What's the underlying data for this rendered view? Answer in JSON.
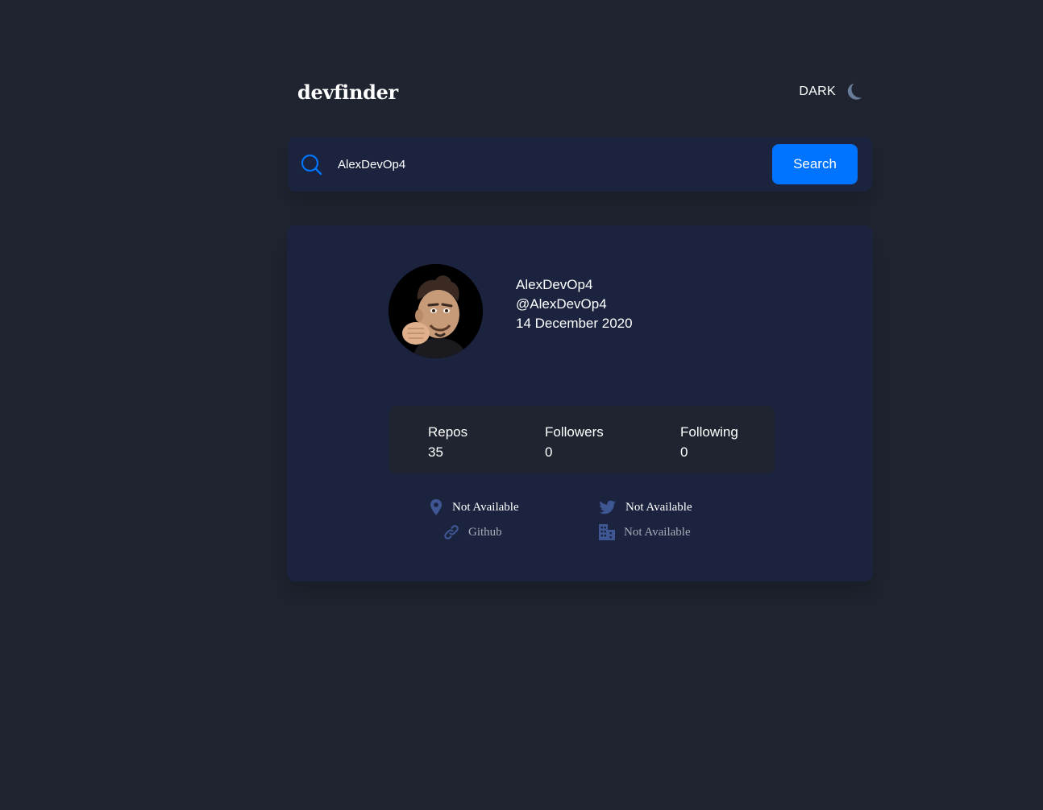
{
  "header": {
    "logo": "devfinder",
    "theme_label": "DARK",
    "theme_icon": "moon-icon"
  },
  "search": {
    "icon": "search-icon",
    "value": "AlexDevOp4",
    "placeholder": "",
    "button_label": "Search"
  },
  "profile": {
    "avatar_alt": "avatar",
    "name": "AlexDevOp4",
    "login": "@AlexDevOp4",
    "joined": "14 December 2020",
    "stats": {
      "repos_label": "Repos",
      "repos_value": "35",
      "followers_label": "Followers",
      "followers_value": "0",
      "following_label": "Following",
      "following_value": "0"
    },
    "links": {
      "location": "Not Available",
      "twitter": "Not Available",
      "blog": "Github",
      "company": "Not Available"
    }
  },
  "colors": {
    "background": "#1f2430",
    "card": "#1b233e",
    "accent": "#0074ff",
    "icon_muted": "#3e5692"
  }
}
